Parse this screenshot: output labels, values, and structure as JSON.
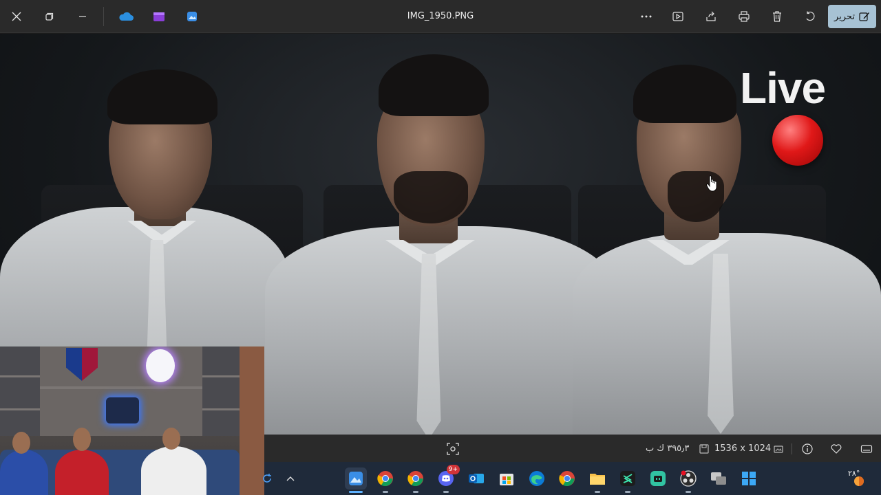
{
  "window": {
    "title": "IMG_1950.PNG",
    "edit_label": "تحرير"
  },
  "photo": {
    "overlay_text": "Live"
  },
  "info_bar": {
    "dimensions": "1536 x 1024",
    "file_size": "٣٩٥٫٣ ك ب"
  },
  "taskbar": {
    "discord_badge": "9+",
    "weather_temp": "٢٨°"
  },
  "colors": {
    "accent": "#a7c2d4",
    "live_red": "#e01818",
    "taskbar_bg": "#1f2a3a"
  }
}
